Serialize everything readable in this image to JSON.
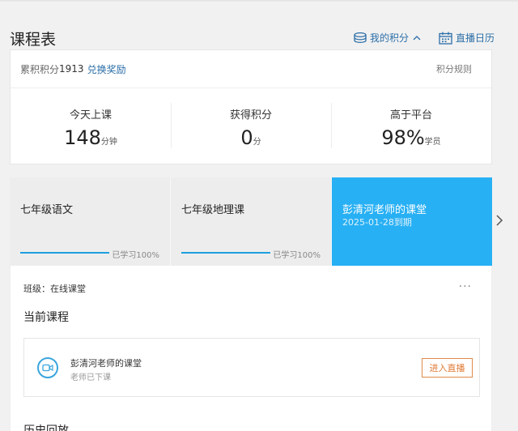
{
  "header": {
    "title": "课程表",
    "my_points_label": "我的积分",
    "calendar_label": "直播日历"
  },
  "points": {
    "accumulated_label": "累积积分",
    "accumulated_value": "1913",
    "redeem_label": "兑换奖励",
    "rules_label": "积分规则",
    "stats": [
      {
        "label": "今天上课",
        "value": "148",
        "unit": "分钟"
      },
      {
        "label": "获得积分",
        "value": "0",
        "unit": "分"
      },
      {
        "label": "高于平台",
        "value": "98%",
        "unit": "学员"
      }
    ]
  },
  "courses": [
    {
      "title": "七年级语文",
      "progress_text": "已学习100%",
      "progress": 1.0
    },
    {
      "title": "七年级地理课",
      "progress_text": "已学习100%",
      "progress": 1.0
    },
    {
      "title": "彭清河老师的课堂",
      "date": "2025-01-28到期"
    }
  ],
  "detail": {
    "class_line": "班级：在线课堂",
    "more": "···",
    "current_title": "当前课程",
    "lesson": {
      "name": "彭清河老师的课堂",
      "status": "老师已下课",
      "button": "进入直播"
    },
    "history_title": "历史回放"
  },
  "colors": {
    "accent": "#28b0f4",
    "link": "#2b6ea8",
    "live_button": "#e07a33"
  },
  "icons": {
    "my_points": "coins-stack-icon",
    "calendar": "calendar-icon",
    "next": "chevron-right-icon",
    "lesson": "video-camera-icon"
  }
}
